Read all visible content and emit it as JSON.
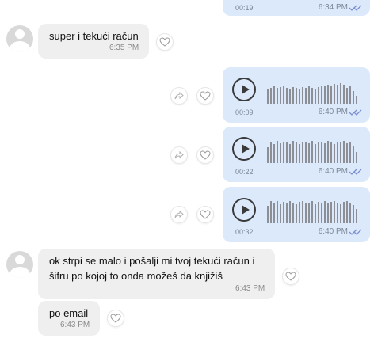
{
  "colors": {
    "incoming_bubble": "#efefef",
    "outgoing_bubble": "#dbe9fb",
    "read_ticks": "#7b8fd0",
    "meta_text": "#7c8796"
  },
  "top_partial": {
    "duration": "00:19",
    "time": "6:34 PM"
  },
  "messages": [
    {
      "text": "super i tekući račun",
      "time": "6:35 PM"
    },
    {
      "text_line1": "ok strpi se malo i pošalji mi tvoj tekući račun i",
      "text_line2": "šifru po kojoj to onda možeš da knjižiš",
      "time": "6:43 PM"
    },
    {
      "text": "po email",
      "time": "6:43 PM"
    }
  ],
  "voice_messages": [
    {
      "duration": "00:09",
      "time": "6:40 PM"
    },
    {
      "duration": "00:22",
      "time": "6:40 PM"
    },
    {
      "duration": "00:32",
      "time": "6:40 PM"
    }
  ],
  "icons": {
    "play": "play-icon",
    "share": "share-icon",
    "heart": "heart-icon",
    "read": "double-check-icon",
    "avatar": "avatar-placeholder"
  }
}
